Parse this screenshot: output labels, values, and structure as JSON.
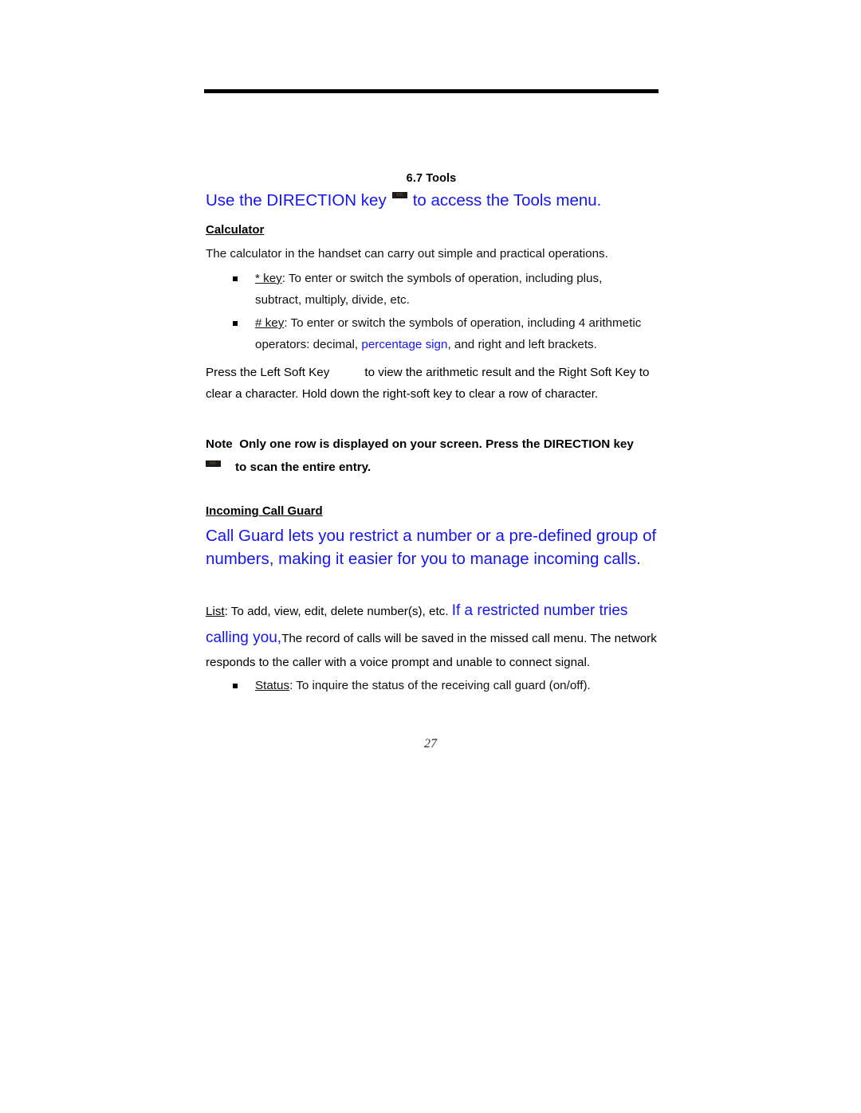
{
  "document": {
    "page_number": "27",
    "accent_blue": "#1515f0",
    "rule_color": "#000000"
  },
  "section": {
    "number_title": "6.7 Tools",
    "lead_before_icon": "Use the DIRECTION key",
    "lead_icon": "direction-key-glyph",
    "lead_after_icon": "to access the Tools menu."
  },
  "calculator": {
    "heading": "Calculator",
    "intro": "The calculator in the handset can carry out simple and practical operations.",
    "bullets": [
      {
        "key_label": "* key",
        "line1": ": To enter or switch the symbols of operation, including plus,",
        "line2": "subtract, multiply, divide, etc."
      },
      {
        "key_label": "# key",
        "line1": ": To enter or switch the symbols of operation, including 4 arithmetic",
        "line2_before_blue": "operators: decimal, ",
        "line2_blue": "percentage sign",
        "line2_after_blue": ", and right and left brackets."
      }
    ],
    "softkey_para_1": "Press the Left Soft Key",
    "softkey_para_2": "to view the arithmetic result and the Right Soft Key",
    "softkey_para_3": "to clear a character. Hold down the right-soft key to clear a row of character."
  },
  "note": {
    "label": "Note",
    "text": "Only one row is displayed on your screen. Press the DIRECTION key",
    "icon": "direction-key-glyph",
    "text_line2": "to scan the entire entry."
  },
  "incoming_call_guard": {
    "heading": "Incoming Call Guard",
    "blue_para_line1": "Call Guard lets you restrict a number or a pre-defined group of",
    "blue_para_line2": "numbers, making it easier for you to manage incoming calls.",
    "list_label": "List",
    "list_black_1": ": To add, view, edit, delete number(s), etc. ",
    "list_blue_1": "If a restricted number tries calling you,",
    "list_black_2": "The record of calls will be saved in the missed call menu. The network responds to the caller with a voice prompt and unable to connect signal.",
    "status_label": "Status",
    "status_text": ": To inquire the status of the receiving call guard (on/off)."
  }
}
